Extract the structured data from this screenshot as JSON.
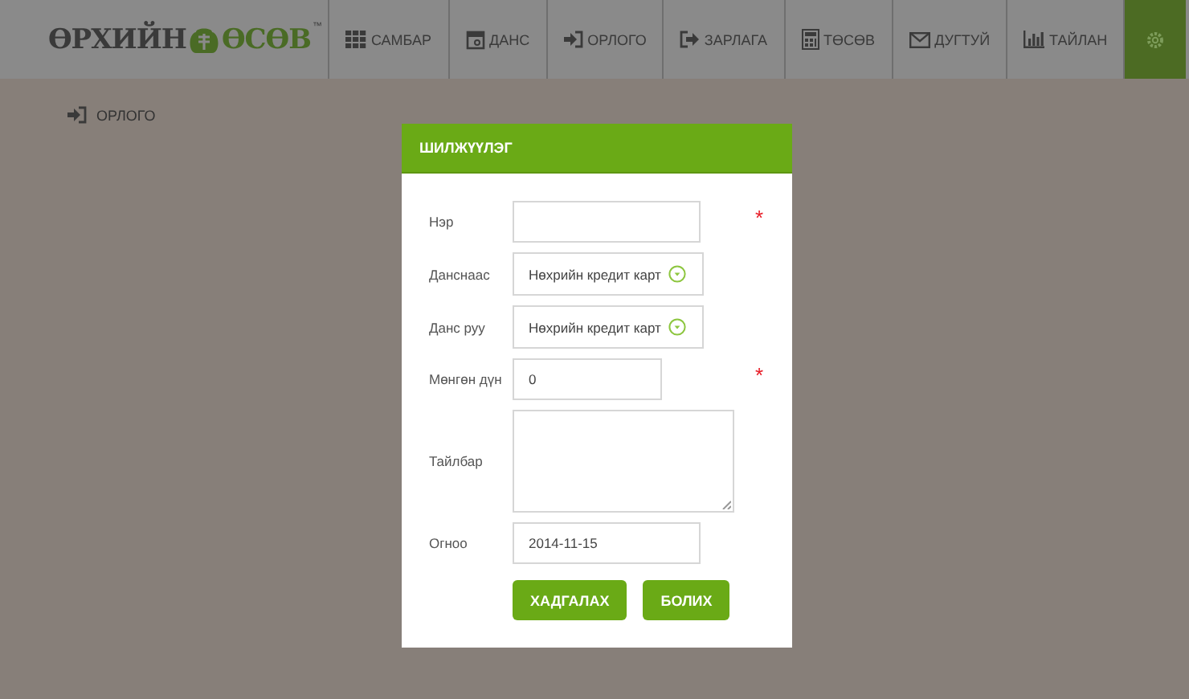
{
  "logo": {
    "left": "ӨРХИЙН",
    "right": "ӨСӨВ",
    "mark": "™"
  },
  "nav": [
    {
      "label": "САМБАР",
      "selected": false
    },
    {
      "label": "ДАНС",
      "selected": false
    },
    {
      "label": "ОРЛОГО",
      "selected": false
    },
    {
      "label": "ЗАРЛАГА",
      "selected": false
    },
    {
      "label": "ТӨСӨВ",
      "selected": false
    },
    {
      "label": "ДУГТУЙ",
      "selected": false
    },
    {
      "label": "ТАЙЛАН",
      "selected": false
    },
    {
      "kind": "settings",
      "selected": true
    }
  ],
  "breadcrumb": "ОРЛОГО",
  "dialog": {
    "title": "ШИЛЖҮҮЛЭГ",
    "fields": [
      {
        "kind": "text",
        "label": "Нэр",
        "required_mark": "*"
      },
      {
        "kind": "select",
        "label": "Данснаас",
        "value": "Нөхрийн кредит карт"
      },
      {
        "kind": "select",
        "label": "Данс руу",
        "value": "Нөхрийн кредит карт"
      },
      {
        "kind": "short",
        "label": "Мөнгөн дүн",
        "value": "0",
        "required_mark": "*"
      },
      {
        "kind": "textarea",
        "label": "Тайлбар"
      },
      {
        "kind": "text",
        "label": "Огноо",
        "value": "2014-11-15"
      }
    ],
    "buttons": [
      "ХАДГАЛАХ",
      "БОЛИХ"
    ]
  }
}
